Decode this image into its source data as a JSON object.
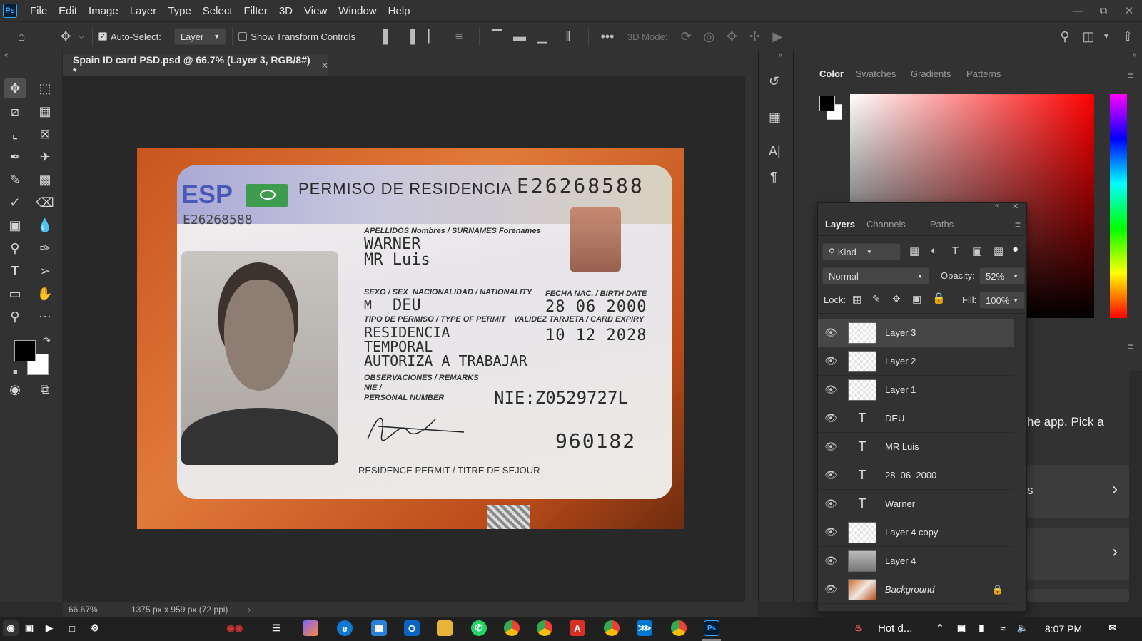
{
  "menu": [
    "File",
    "Edit",
    "Image",
    "Layer",
    "Type",
    "Select",
    "Filter",
    "3D",
    "View",
    "Window",
    "Help"
  ],
  "app_logo": "Ps",
  "options": {
    "auto_select_label": "Auto-Select:",
    "auto_select_value": "Layer",
    "transform_label": "Show Transform Controls",
    "mode_3d_label": "3D Mode:"
  },
  "document": {
    "tab_title": "Spain ID card PSD.psd @ 66.7% (Layer 3, RGB/8#) *",
    "zoom": "66.67%",
    "dimensions": "1375 px x 959 px (72 ppi)"
  },
  "card": {
    "country": "ESP",
    "title": "PERMISO DE RESIDENCIA",
    "doc_number": "E26268588",
    "doc_number_small": "E26268588",
    "label_names": "APELLIDOS Nombres / SURNAMES Forenames",
    "surname": "WARNER",
    "forename": "MR Luis",
    "label_sex": "SEXO / SEX",
    "label_nationality": "NACIONALIDAD / NATIONALITY",
    "label_birth": "FECHA NAC. / BIRTH DATE",
    "sex": "M",
    "nationality": "DEU",
    "birth_date": "28 06 2000",
    "label_permit_type": "TIPO DE PERMISO / TYPE OF PERMIT",
    "label_expiry": "VALIDEZ TARJETA / CARD EXPIRY",
    "permit_line1": "RESIDENCIA",
    "permit_line2": "TEMPORAL",
    "permit_line3": "AUTORIZA A TRABAJAR",
    "expiry": "10 12 2028",
    "label_remarks": "OBSERVACIONES / REMARKS",
    "label_nie": "NIE /",
    "label_personal": "PERSONAL NUMBER",
    "nie": "NIE:Z0529727L",
    "support_number": "960182",
    "footer": "RESIDENCE PERMIT / TITRE DE SEJOUR"
  },
  "color_panel": {
    "tabs": [
      "Color",
      "Swatches",
      "Gradients",
      "Patterns"
    ]
  },
  "layers_panel": {
    "tabs": [
      "Layers",
      "Channels",
      "Paths"
    ],
    "kind_label": "Kind",
    "blend_mode": "Normal",
    "opacity_label": "Opacity:",
    "opacity_value": "52%",
    "lock_label": "Lock:",
    "fill_label": "Fill:",
    "fill_value": "100%",
    "layers": [
      {
        "name": "Layer 3",
        "type": "pixel"
      },
      {
        "name": "Layer 2",
        "type": "pixel"
      },
      {
        "name": "Layer 1",
        "type": "pixel"
      },
      {
        "name": "DEU",
        "type": "text"
      },
      {
        "name": "MR Luis",
        "type": "text"
      },
      {
        "name": "28  06  2000",
        "type": "text"
      },
      {
        "name": "Warner",
        "type": "text"
      },
      {
        "name": "Layer 4 copy",
        "type": "pixel"
      },
      {
        "name": "Layer 4",
        "type": "pixel"
      },
      {
        "name": "Background",
        "type": "pixel"
      }
    ]
  },
  "side_panel": {
    "partial_text": "he app. Pick a",
    "card_text": "s"
  },
  "taskbar": {
    "weather": "Hot d...",
    "time": "8:07 PM"
  },
  "colors": {
    "accent": "#31a8ff",
    "panel_bg": "#323232",
    "canvas_bg": "#282828"
  }
}
